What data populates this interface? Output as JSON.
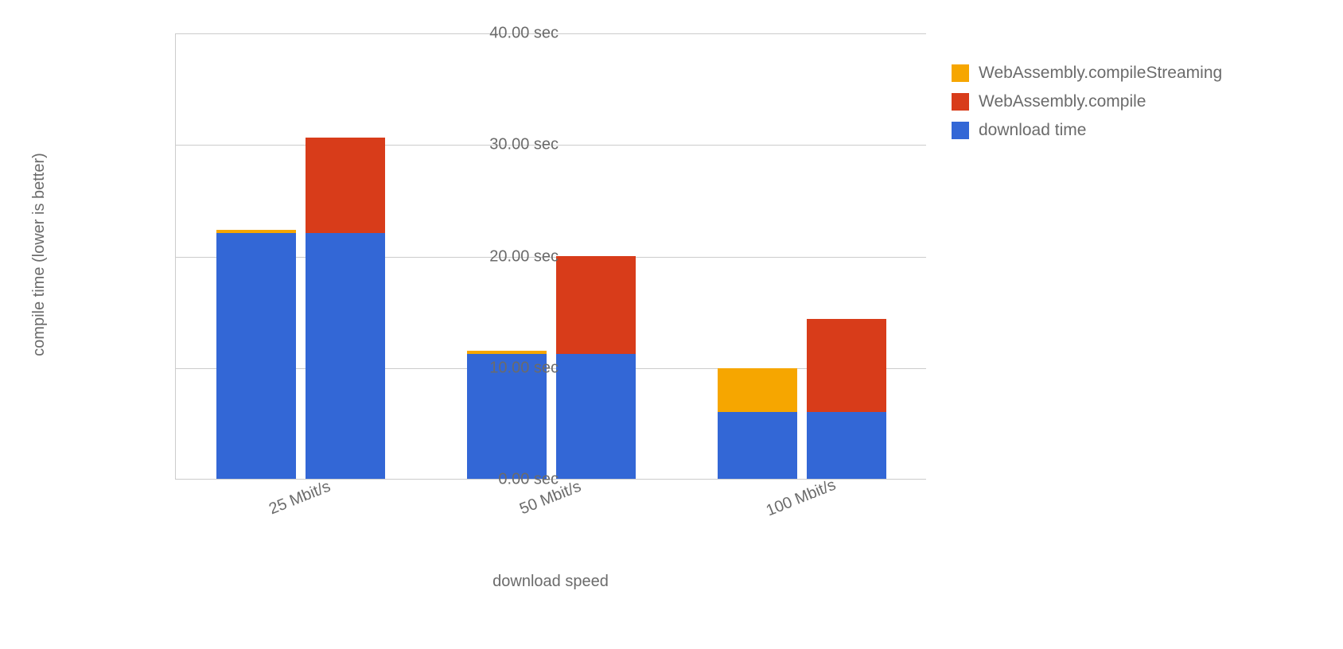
{
  "chart_data": {
    "type": "bar",
    "title": "",
    "xlabel": "download speed",
    "ylabel": "compile time (lower is better)",
    "ylim": [
      0,
      40
    ],
    "y_ticks": [
      0,
      10,
      20,
      30,
      40
    ],
    "y_tick_labels": [
      "0.00 sec",
      "10.00 sec",
      "20.00 sec",
      "30.00 sec",
      "40.00 sec"
    ],
    "categories": [
      "25 Mbit/s",
      "50 Mbit/s",
      "100 Mbit/s"
    ],
    "stack_order_bottom_to_top": [
      "download time",
      "WebAssembly.compileStreaming",
      "WebAssembly.compile"
    ],
    "groups": [
      {
        "category": "25 Mbit/s",
        "bars": [
          {
            "segments": {
              "download time": 22.0,
              "WebAssembly.compileStreaming": 0.3,
              "WebAssembly.compile": 0
            }
          },
          {
            "segments": {
              "download time": 22.0,
              "WebAssembly.compileStreaming": 0,
              "WebAssembly.compile": 8.6
            }
          }
        ]
      },
      {
        "category": "50 Mbit/s",
        "bars": [
          {
            "segments": {
              "download time": 11.2,
              "WebAssembly.compileStreaming": 0.3,
              "WebAssembly.compile": 0
            }
          },
          {
            "segments": {
              "download time": 11.2,
              "WebAssembly.compileStreaming": 0,
              "WebAssembly.compile": 8.8
            }
          }
        ]
      },
      {
        "category": "100 Mbit/s",
        "bars": [
          {
            "segments": {
              "download time": 6.0,
              "WebAssembly.compileStreaming": 3.9,
              "WebAssembly.compile": 0
            }
          },
          {
            "segments": {
              "download time": 6.0,
              "WebAssembly.compileStreaming": 0,
              "WebAssembly.compile": 8.3
            }
          }
        ]
      }
    ],
    "series_colors": {
      "WebAssembly.compileStreaming": "#f6a600",
      "WebAssembly.compile": "#d83c1a",
      "download time": "#3367d6"
    },
    "legend": [
      "WebAssembly.compileStreaming",
      "WebAssembly.compile",
      "download time"
    ]
  }
}
